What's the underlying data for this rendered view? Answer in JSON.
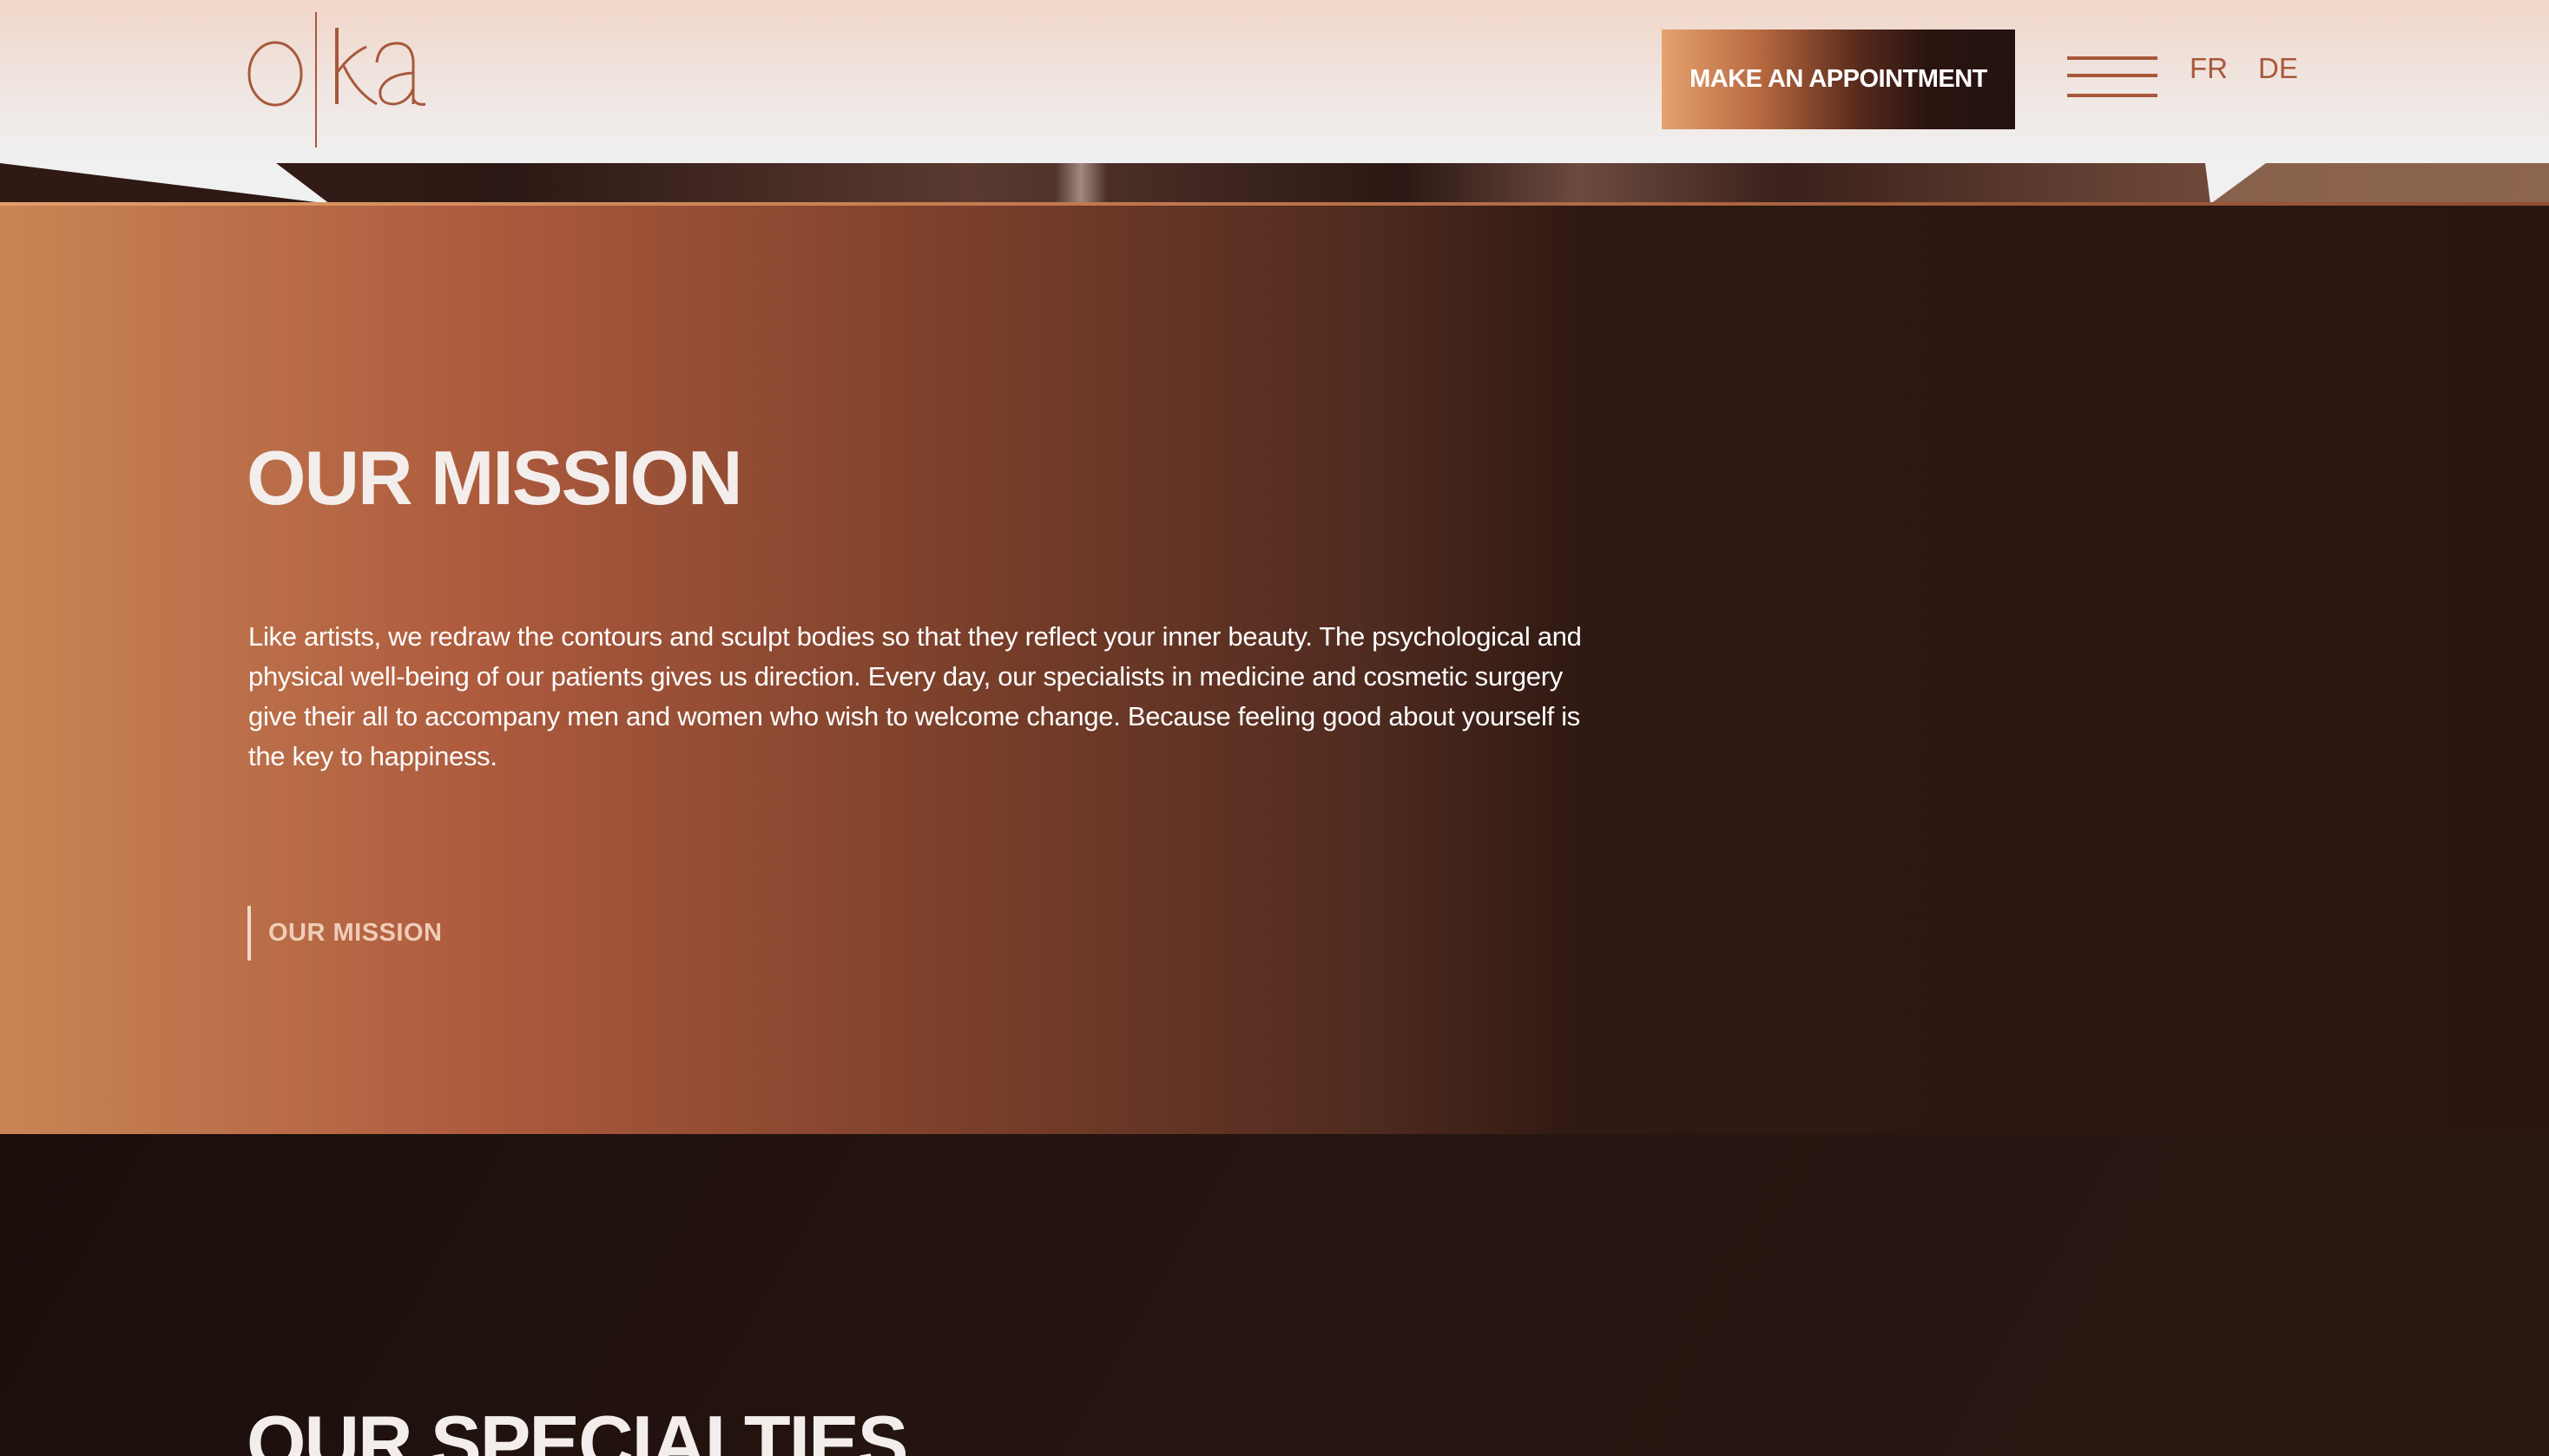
{
  "header": {
    "logo_text": "oka",
    "appointment_button": "MAKE AN APPOINTMENT",
    "languages": [
      "FR",
      "DE"
    ]
  },
  "mission": {
    "title": "OUR MISSION",
    "text": "Like artists, we redraw the contours and sculpt bodies so that they reflect your inner beauty. The psychological and physical well-being of our patients gives us direction. Every day, our specialists in medicine and cosmetic surgery give their all to accompany men and women who wish to welcome change. Because feeling good about yourself is the key to happiness.",
    "link_label": "OUR MISSION"
  },
  "specialties": {
    "title": "OUR SPECIALTIES"
  },
  "colors": {
    "brand_copper": "#a8583b",
    "dark_brown": "#2a1510",
    "light_copper": "#c98555"
  },
  "icons": {
    "menu": "hamburger-menu-icon"
  }
}
